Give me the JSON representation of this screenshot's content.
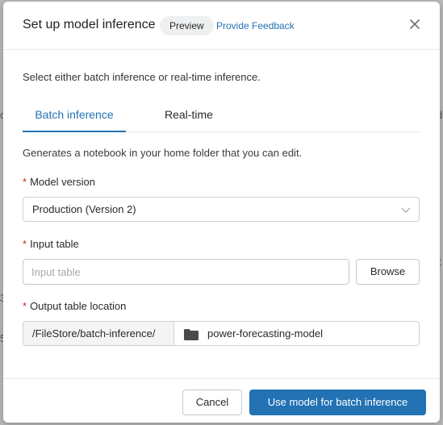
{
  "background": {
    "fragments": [
      "c",
      "di",
      "3",
      "5",
      "t"
    ]
  },
  "dialog": {
    "title": "Set up model inference",
    "badge": "Preview",
    "feedback_link": "Provide Feedback",
    "close_icon": "close-icon"
  },
  "intro": "Select either batch inference or real-time inference.",
  "tabs": [
    {
      "label": "Batch inference",
      "active": true
    },
    {
      "label": "Real-time",
      "active": false
    }
  ],
  "batch": {
    "description": "Generates a notebook in your home folder that you can edit.",
    "required_marker": "*",
    "model_version": {
      "label": "Model version",
      "value": "Production (Version 2)"
    },
    "input_table": {
      "label": "Input table",
      "value": "",
      "placeholder": "Input table",
      "browse_label": "Browse"
    },
    "output_location": {
      "label": "Output table location",
      "prefix": "/FileStore/batch-inference/",
      "value": "power-forecasting-model",
      "icon": "folder-icon"
    }
  },
  "footer": {
    "cancel_label": "Cancel",
    "submit_label": "Use model for batch inference"
  },
  "colors": {
    "accent": "#2272b4",
    "required": "#c82d1f",
    "overlay": "#b9b9b9"
  }
}
